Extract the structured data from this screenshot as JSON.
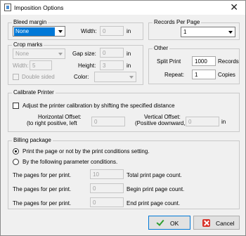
{
  "window": {
    "title": "Imposition Options",
    "close_glyph": "✕"
  },
  "bleed_margin": {
    "legend": "Bleed margin",
    "selected": "None",
    "width_label": "Width:",
    "width_value": "0",
    "width_unit": "in"
  },
  "crop_marks": {
    "legend": "Crop marks",
    "selected": "None",
    "gap_label": "Gap size:",
    "gap_value": "0",
    "gap_unit": "in",
    "width_label": "Width:",
    "width_value": "5",
    "height_label": "Height:",
    "height_value": "3",
    "height_unit": "in",
    "double_sided_label": "Double sided",
    "color_label": "Color:",
    "color_value": ""
  },
  "records_per_page": {
    "legend": "Records Per Page",
    "selected": "1"
  },
  "other": {
    "legend": "Other",
    "split_label": "Split Print",
    "split_value": "1000",
    "split_unit": "Records",
    "repeat_label": "Repeat:",
    "repeat_value": "1",
    "repeat_unit": "Copies"
  },
  "calibrate": {
    "legend": "Calibrate Printer",
    "adjust_label": "Adjust the printer calibration by shifting the specified distance",
    "h_offset_line1": "Horizontal Offset:",
    "h_offset_line2": "(to right positive, left",
    "h_offset_value": "0",
    "v_offset_line1": "Vertical Offset:",
    "v_offset_line2": "(Positive downward,",
    "v_offset_value": "0",
    "v_offset_unit": "in"
  },
  "billing": {
    "legend": "Billing package",
    "option1": "Print the page or not by the print conditions setting.",
    "option2": "By the following parameter conditions.",
    "rows": [
      {
        "label": "The pages for per print.",
        "value": "10",
        "desc": "Total print page count."
      },
      {
        "label": "The pages for per print.",
        "value": "0",
        "desc": "Begin print page count."
      },
      {
        "label": "The pages for per print.",
        "value": "0",
        "desc": "End print page count."
      }
    ]
  },
  "buttons": {
    "ok": "OK",
    "cancel": "Cancel"
  },
  "icons": {
    "ok": "check-icon",
    "cancel": "cancel-icon",
    "app": "app-icon"
  },
  "colors": {
    "selection": "#0078d7",
    "dialog_bg": "#f0f0f0",
    "ok_check": "#2f9e2f",
    "cancel_red": "#d9342b"
  }
}
